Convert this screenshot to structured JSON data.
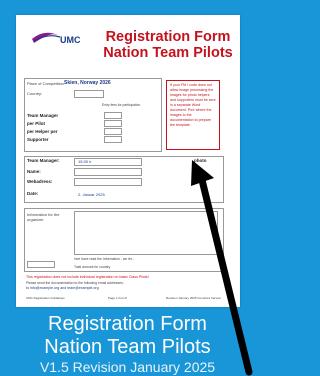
{
  "document": {
    "org_name": "UMC",
    "title_line1": "Registration Form",
    "title_line2": "Nation Team Pilots",
    "place_label": "Place of Competition",
    "place_value": "Skien, Norway 2026",
    "country_label": "Country:",
    "entry_fee_note": "Entry fees for participation",
    "team_manager_label": "Team Manager",
    "per_pilot_label": "per Pilot",
    "per_helper_label": "per Helper per",
    "supporter_label": "Supporter",
    "manager_label": "Team Manager:",
    "manager_value": "15:30 h",
    "photo_label": "photo",
    "name_label": "Name:",
    "webadress_label": "Webadress:",
    "date_label": "Date:",
    "date_value": "2. Januar 2025",
    "info_label": "Information for the organizer",
    "signature_note": "I/we have read the Information - we let...",
    "total_note": "Total amount for country",
    "red_note": "This registration does not include individual registration on basic Class Pilots!",
    "contact_note": "Please send the documentation to the following email addresses:",
    "contact_emails": "to info@example.org and team@example.org",
    "footer_left": "UMC Registration Guidelines",
    "footer_mid": "Page 1 from 8",
    "footer_right": "Revision January 2025 Countries Version",
    "red_box_text": "If your FM / code does not allow image processing the images for photo helpers and supporters must be sent in a separate Word document. Pict: where the images to the documentation to prepare the template."
  },
  "caption": {
    "line1": "Registration Form",
    "line2": "Nation Team Pilots",
    "line3": "V1.5 Revision January 2025"
  },
  "colors": {
    "background": "#1996d8",
    "title_red": "#c4131e",
    "arrow": "#000000"
  }
}
